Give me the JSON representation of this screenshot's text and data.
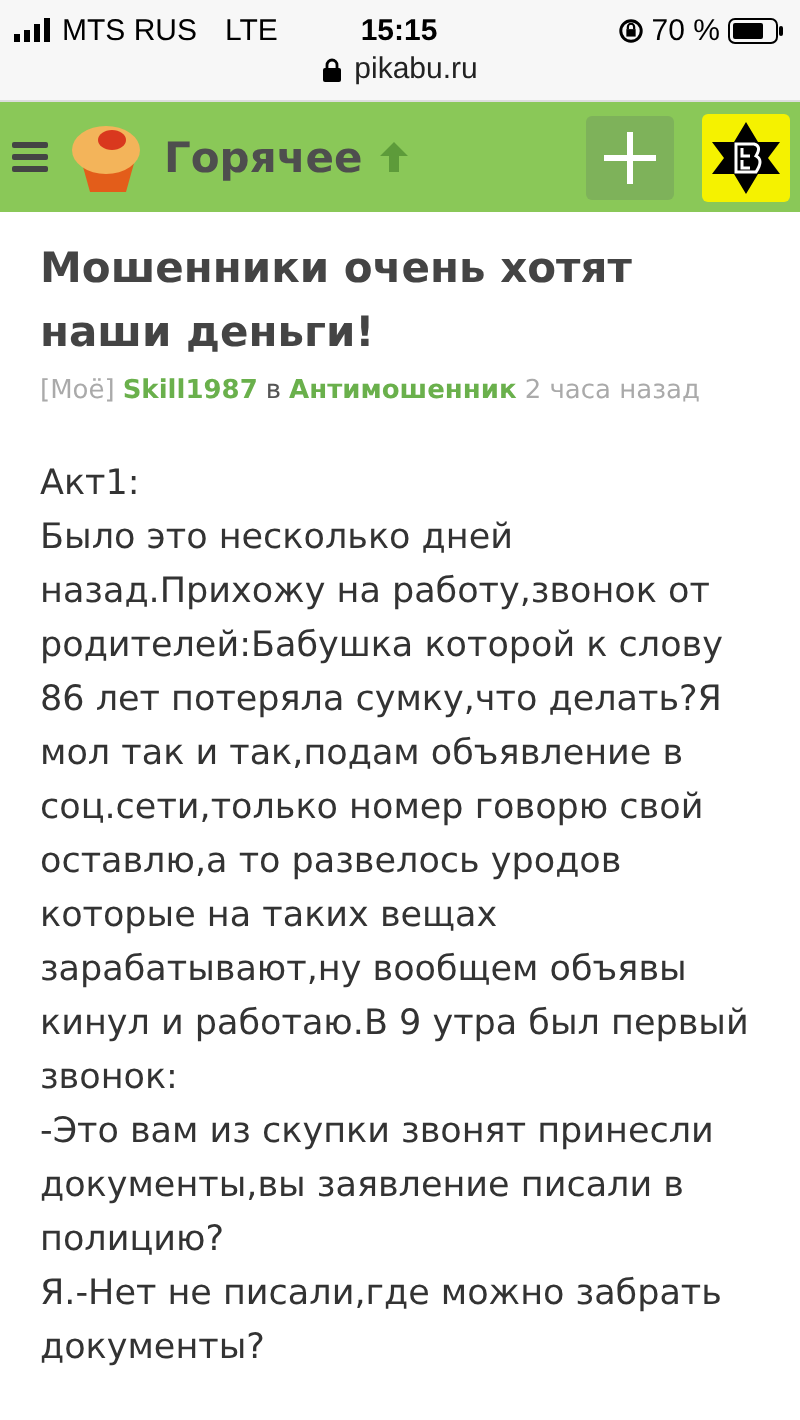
{
  "status_bar": {
    "carrier": "MTS RUS",
    "network": "LTE",
    "time": "15:15",
    "battery": "70 %",
    "url": "pikabu.ru"
  },
  "header": {
    "title": "Горячее"
  },
  "post": {
    "title": "Мошенники очень хотят наши деньги!",
    "tag": "[Моё]",
    "author": "Skill1987",
    "preposition": "в",
    "community": "Антимошенник",
    "time": "2 часа назад",
    "paragraphs": [
      "Акт1:",
      "Было это несколько дней назад.Прихожу на работу,звонок от родителей:Бабушка которой к слову 86 лет потеряла сумку,что делать?Я мол так и так,подам объявление в соц.сети,только номер говорю свой оставлю,а то развелось уродов которые на таких вещах зарабатывают,ну вообщем объявы кинул и работаю.В 9 утра был первый звонок:",
      "-Это вам из скупки звонят принесли документы,вы заявление писали в полицию?",
      "Я.-Нет не писали,где можно забрать документы?"
    ]
  }
}
